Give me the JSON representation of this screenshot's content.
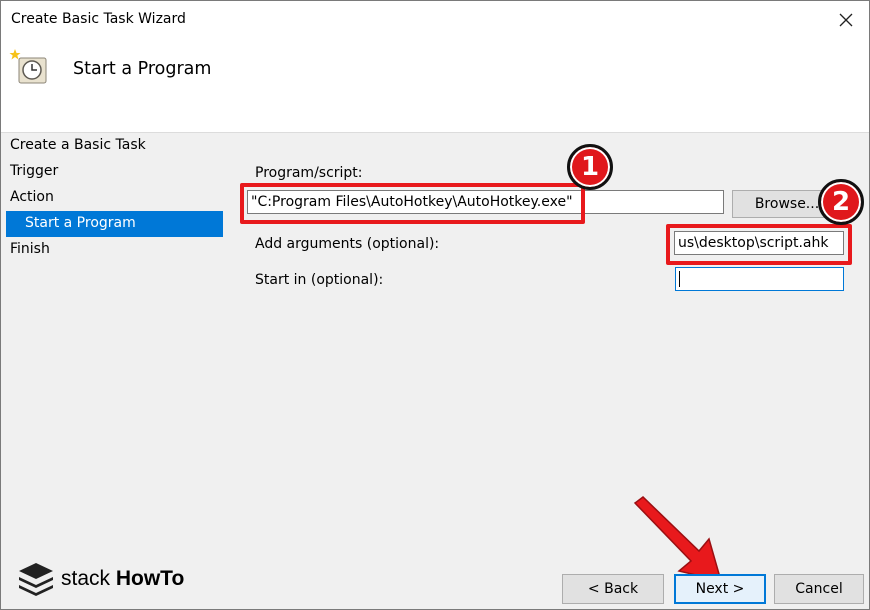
{
  "window": {
    "title": "Create Basic Task Wizard"
  },
  "header": {
    "title": "Start a Program"
  },
  "nav": {
    "items": [
      {
        "label": "Create a Basic Task"
      },
      {
        "label": "Trigger"
      },
      {
        "label": "Action"
      },
      {
        "label": "Start a Program",
        "selected": true
      },
      {
        "label": "Finish"
      }
    ]
  },
  "form": {
    "program_label": "Program/script:",
    "program_value": "\"C:Program Files\\AutoHotkey\\AutoHotkey.exe\"",
    "browse_label": "Browse...",
    "arguments_label": "Add arguments (optional):",
    "arguments_value": "us\\desktop\\script.ahk",
    "startin_label": "Start in (optional):",
    "startin_value": ""
  },
  "footer": {
    "back_label": "< Back",
    "next_label": "Next >",
    "cancel_label": "Cancel"
  },
  "annotations": {
    "badge1": "1",
    "badge2": "2"
  },
  "logo": {
    "prefix": "stack",
    "suffix": "HowTo"
  },
  "colors": {
    "accent": "#0078d7",
    "highlight": "#e8191c"
  },
  "icons": {
    "close": "close-icon",
    "header": "scheduled-task-clock-icon",
    "logo": "stacked-layers-icon",
    "arrow": "red-arrow-icon"
  }
}
